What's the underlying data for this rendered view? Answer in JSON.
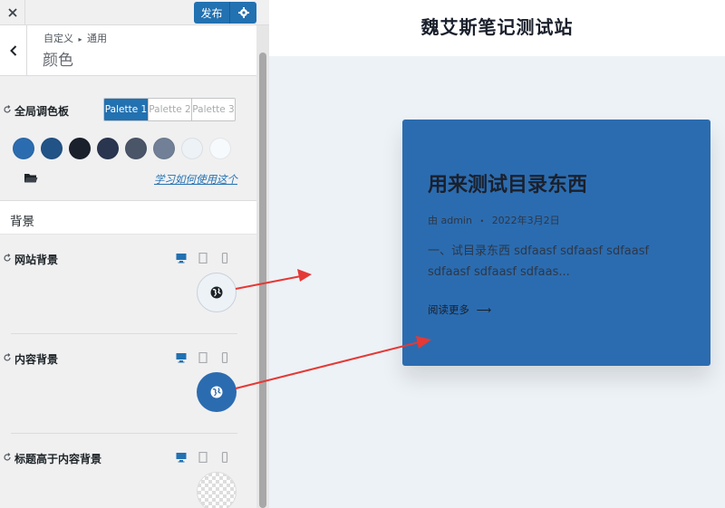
{
  "topbar": {
    "publish_label": "发布"
  },
  "section": {
    "breadcrumb_parent": "自定义",
    "breadcrumb_separator": "▸",
    "breadcrumb_child": "通用",
    "title": "颜色"
  },
  "palette": {
    "label": "全局调色板",
    "tabs": [
      "Palette 1",
      "Palette 2",
      "Palette 3"
    ],
    "active_tab": "Palette 1",
    "swatch_colors": [
      "#2b6cb0",
      "#215387",
      "#1a202c",
      "#2a3550",
      "#4a5568",
      "#718096",
      "#edf2f7",
      "#f7fafc"
    ],
    "learn_link": "学习如何使用这个"
  },
  "background_group": {
    "title": "背景",
    "controls": [
      {
        "label": "网站背景",
        "value_color": "#edf2f7"
      },
      {
        "label": "内容背景",
        "value_color": "#2b6cb0"
      },
      {
        "label": "标题高于内容背景",
        "value_color": "transparent"
      }
    ]
  },
  "preview": {
    "site_title": "魏艾斯笔记测试站",
    "post": {
      "title": "用来测试目录东西",
      "meta_by": "由 admin",
      "meta_dot": "•",
      "meta_date": "2022年3月2日",
      "excerpt": "一、试目录东西 sdfaasf sdfaasf sdfaasf sdfaasf sdfaasf sdfaas...",
      "read_more": "阅读更多",
      "read_more_arrow": "⟶"
    }
  },
  "colors": {
    "accent": "#2271b1",
    "annotation_arrow": "#e53935"
  }
}
